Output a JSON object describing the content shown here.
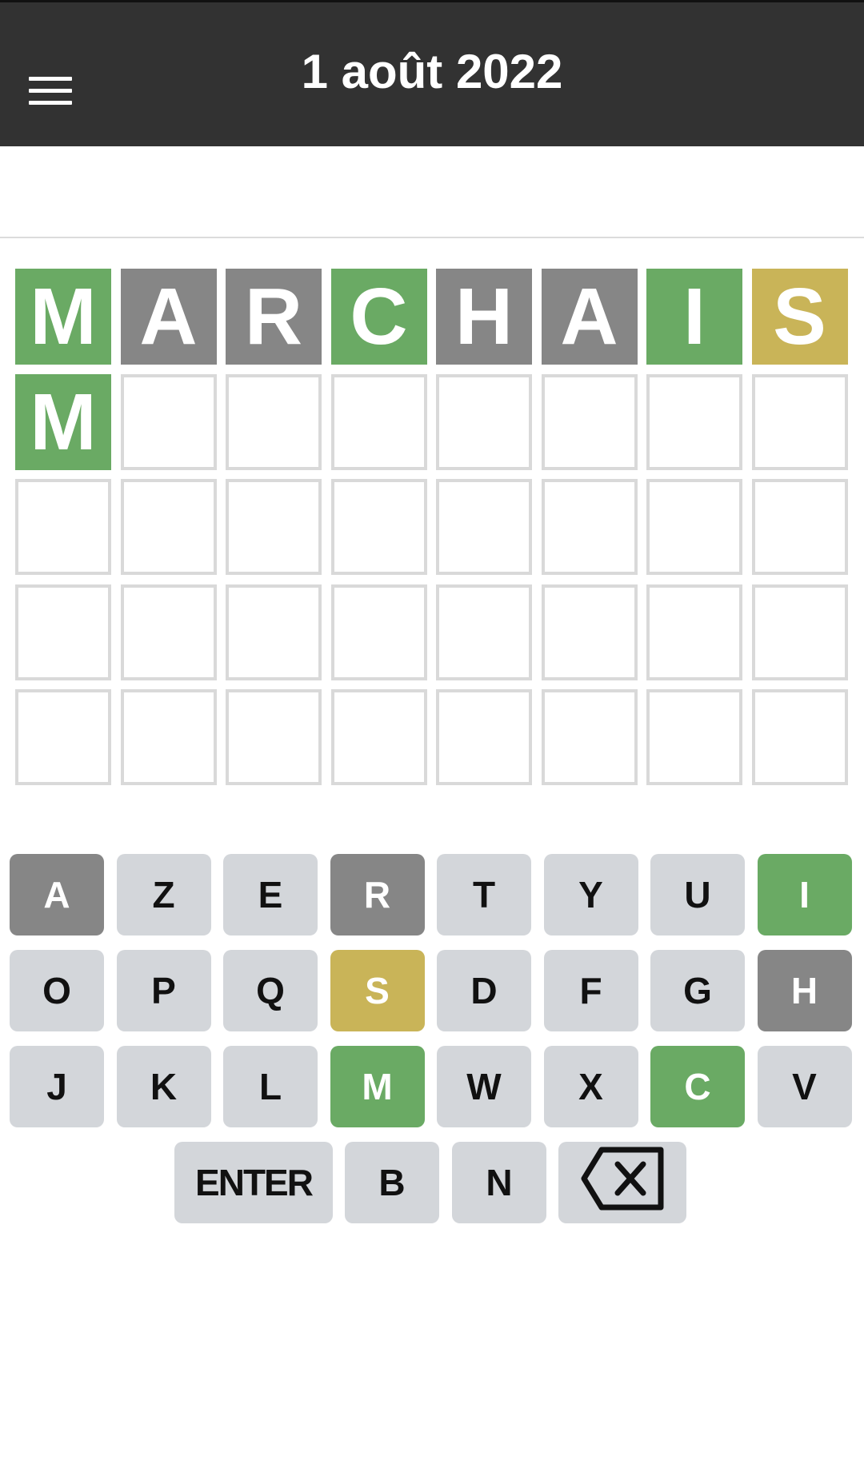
{
  "header": {
    "title": "1 août 2022",
    "menu_icon": "hamburger-menu-icon"
  },
  "colors": {
    "correct": "#6aaa64",
    "present": "#c9b458",
    "absent": "#868686",
    "key_default": "#d3d6da",
    "header_bg": "#323232"
  },
  "board": {
    "rows": [
      {
        "letters": [
          "M",
          "A",
          "R",
          "C",
          "H",
          "A",
          "I",
          "S"
        ],
        "states": [
          "correct",
          "absent",
          "absent",
          "correct",
          "absent",
          "absent",
          "correct",
          "present"
        ]
      },
      {
        "letters": [
          "M",
          "",
          "",
          "",
          "",
          "",
          "",
          ""
        ],
        "states": [
          "correct",
          "empty",
          "empty",
          "empty",
          "empty",
          "empty",
          "empty",
          "empty"
        ]
      },
      {
        "letters": [
          "",
          "",
          "",
          "",
          "",
          "",
          "",
          ""
        ],
        "states": [
          "empty",
          "empty",
          "empty",
          "empty",
          "empty",
          "empty",
          "empty",
          "empty"
        ]
      },
      {
        "letters": [
          "",
          "",
          "",
          "",
          "",
          "",
          "",
          ""
        ],
        "states": [
          "empty",
          "empty",
          "empty",
          "empty",
          "empty",
          "empty",
          "empty",
          "empty"
        ]
      },
      {
        "letters": [
          "",
          "",
          "",
          "",
          "",
          "",
          "",
          ""
        ],
        "states": [
          "empty",
          "empty",
          "empty",
          "empty",
          "empty",
          "empty",
          "empty",
          "empty"
        ]
      }
    ]
  },
  "keyboard": {
    "rows": [
      [
        {
          "label": "A",
          "state": "absent"
        },
        {
          "label": "Z",
          "state": "default"
        },
        {
          "label": "E",
          "state": "default"
        },
        {
          "label": "R",
          "state": "absent"
        },
        {
          "label": "T",
          "state": "default"
        },
        {
          "label": "Y",
          "state": "default"
        },
        {
          "label": "U",
          "state": "default"
        },
        {
          "label": "I",
          "state": "correct"
        }
      ],
      [
        {
          "label": "O",
          "state": "default"
        },
        {
          "label": "P",
          "state": "default"
        },
        {
          "label": "Q",
          "state": "default"
        },
        {
          "label": "S",
          "state": "present"
        },
        {
          "label": "D",
          "state": "default"
        },
        {
          "label": "F",
          "state": "default"
        },
        {
          "label": "G",
          "state": "default"
        },
        {
          "label": "H",
          "state": "absent"
        }
      ],
      [
        {
          "label": "J",
          "state": "default"
        },
        {
          "label": "K",
          "state": "default"
        },
        {
          "label": "L",
          "state": "default"
        },
        {
          "label": "M",
          "state": "correct"
        },
        {
          "label": "W",
          "state": "default"
        },
        {
          "label": "X",
          "state": "default"
        },
        {
          "label": "C",
          "state": "correct"
        },
        {
          "label": "V",
          "state": "default"
        }
      ],
      [
        {
          "label": "ENTER",
          "state": "default",
          "type": "enter"
        },
        {
          "label": "B",
          "state": "default"
        },
        {
          "label": "N",
          "state": "default"
        },
        {
          "label": "",
          "state": "default",
          "type": "backspace",
          "icon": "backspace-icon"
        }
      ]
    ]
  }
}
